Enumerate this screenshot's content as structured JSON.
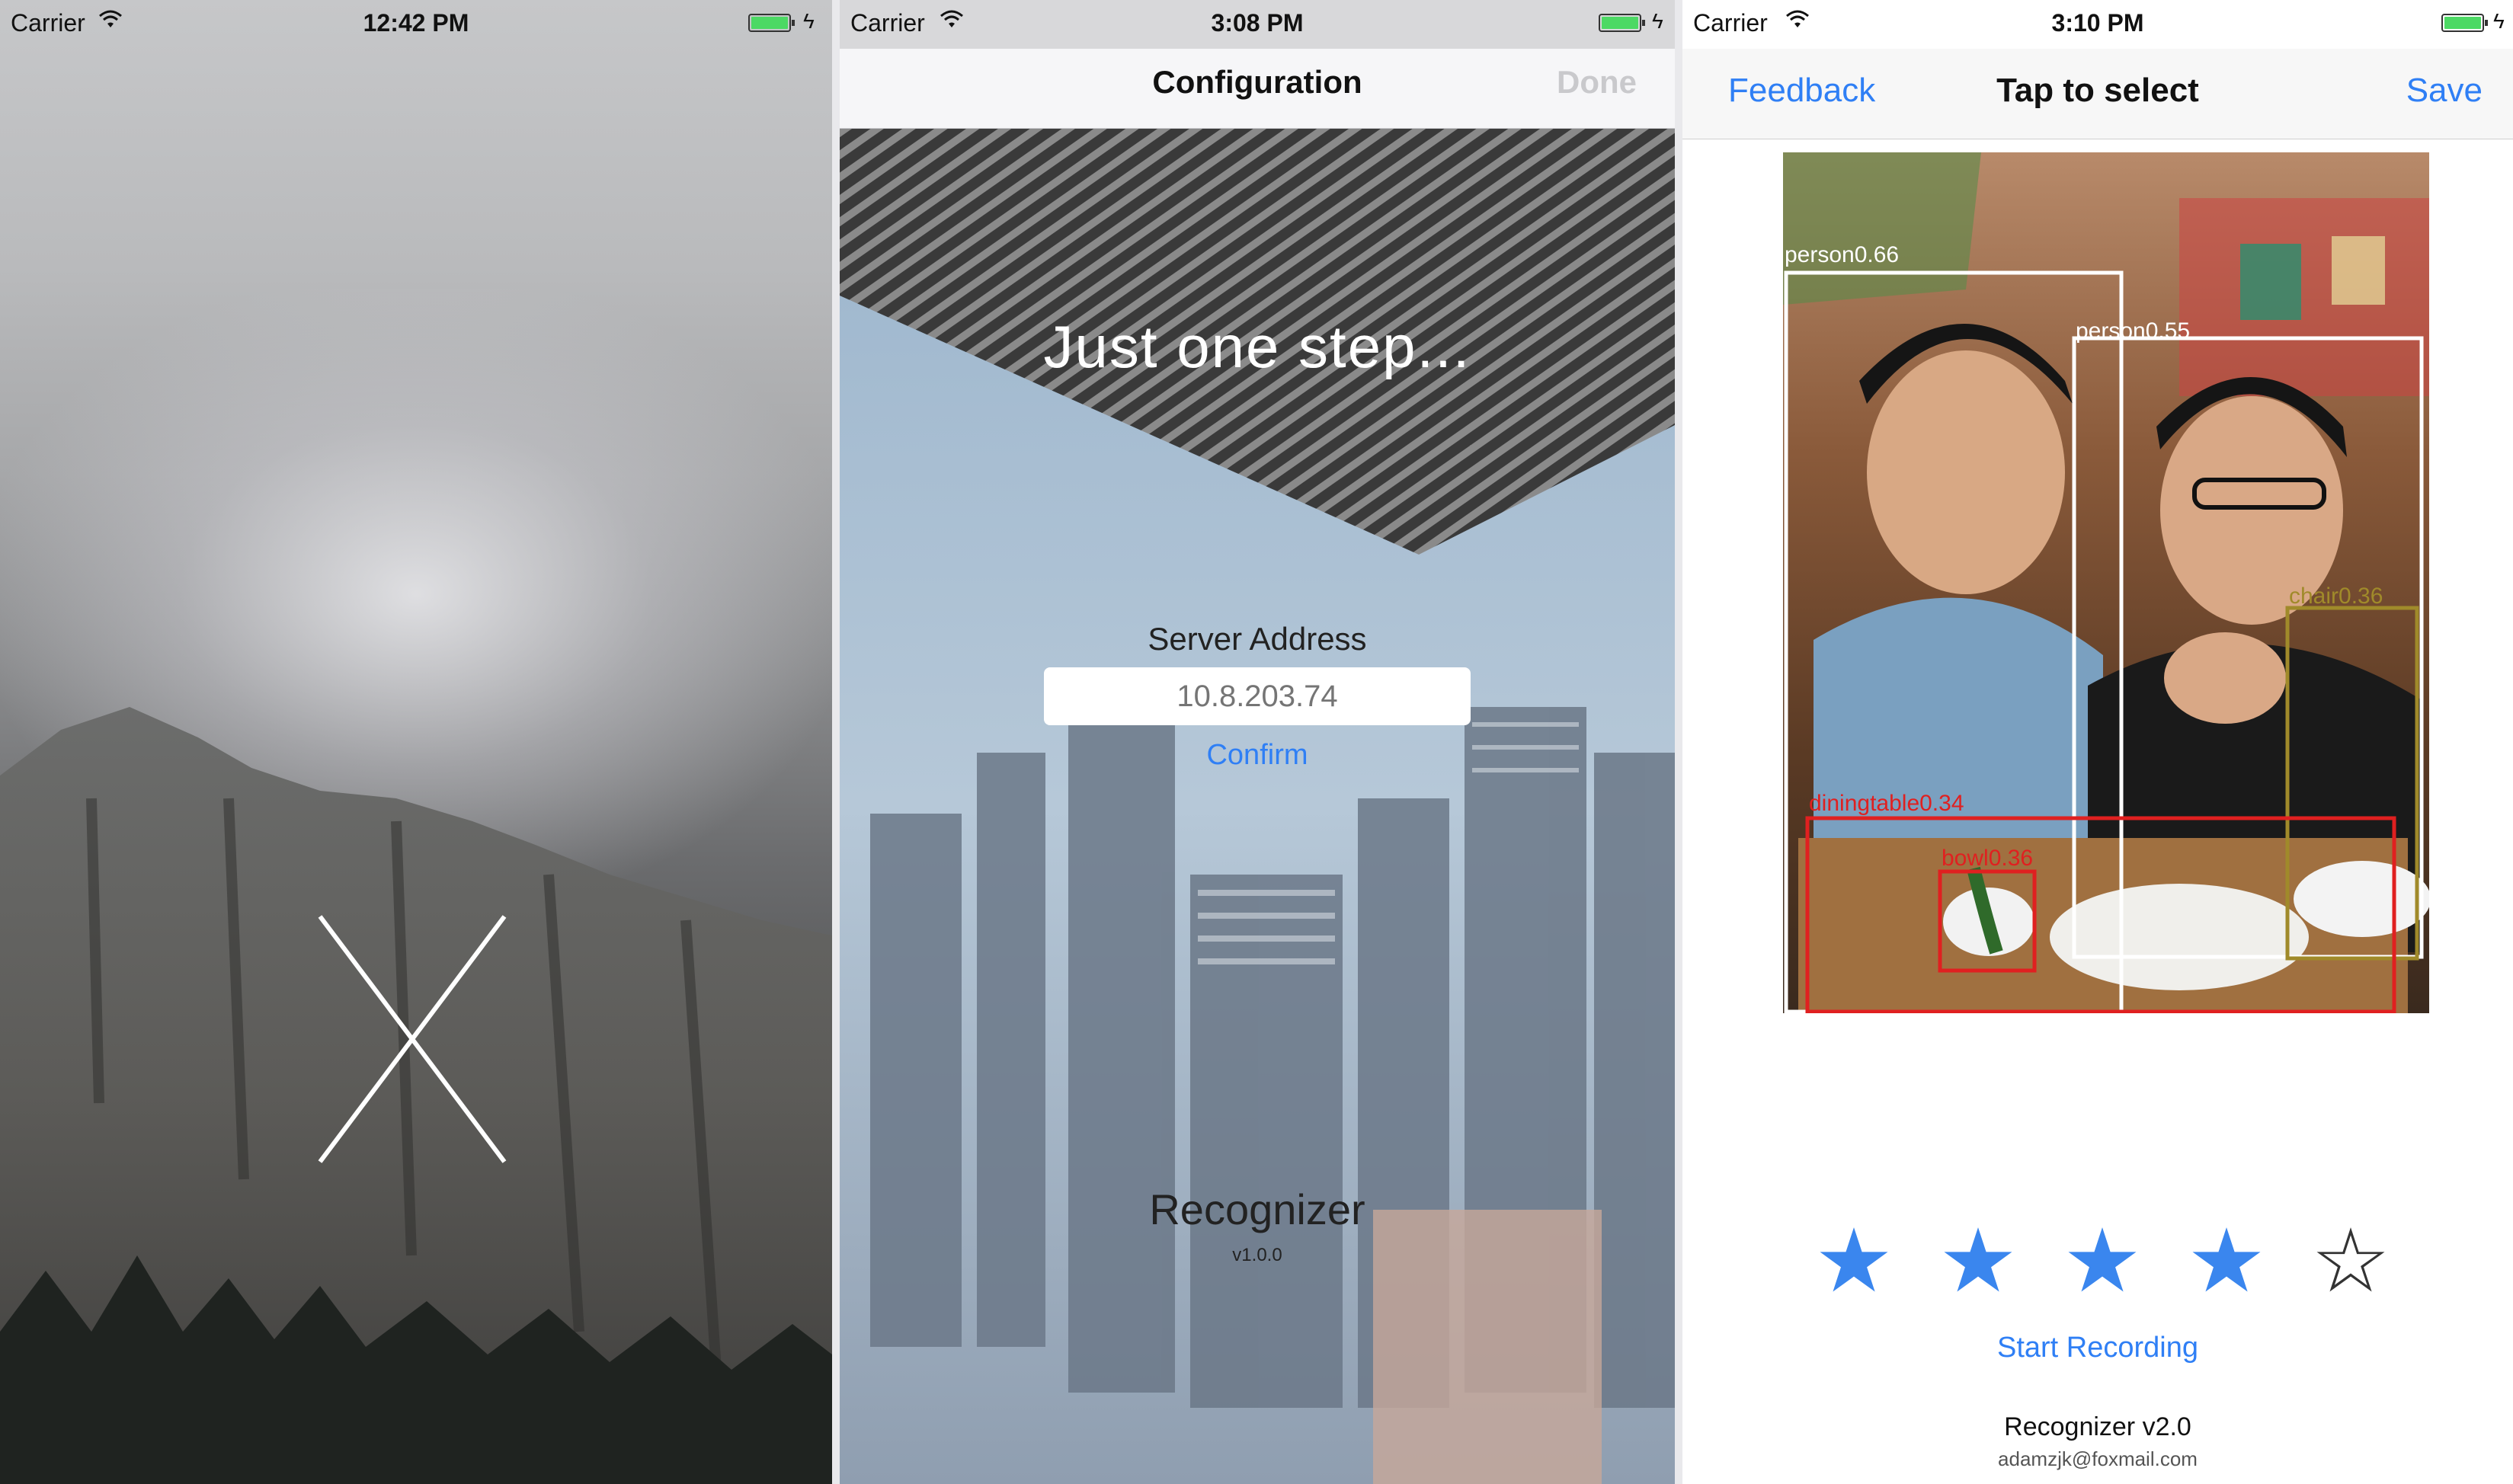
{
  "screen1": {
    "status": {
      "carrier": "Carrier",
      "time": "12:42 PM"
    }
  },
  "screen2": {
    "status": {
      "carrier": "Carrier",
      "time": "3:08 PM"
    },
    "nav": {
      "title": "Configuration",
      "done_label": "Done"
    },
    "headline": "Just one step...",
    "server_label": "Server Address",
    "server_placeholder": "10.8.203.74",
    "confirm_label": "Confirm",
    "app_name": "Recognizer",
    "app_version": "v1.0.0"
  },
  "screen3": {
    "status": {
      "carrier": "Carrier",
      "time": "3:10 PM"
    },
    "nav": {
      "left_label": "Feedback",
      "title": "Tap to select",
      "right_label": "Save"
    },
    "detections": [
      {
        "label": "person0.66",
        "color": "#ffffff"
      },
      {
        "label": "person0.55",
        "color": "#ffffff"
      },
      {
        "label": "chair0.36",
        "color": "#a08a2a"
      },
      {
        "label": "diningtable0.34",
        "color": "#e02020"
      },
      {
        "label": "bowl0.36",
        "color": "#e02020"
      }
    ],
    "rating": {
      "value": 4,
      "max": 5
    },
    "start_recording_label": "Start Recording",
    "footer_name": "Recognizer v2.0",
    "footer_email": "adamzjk@foxmail.com"
  },
  "colors": {
    "accent": "#2f7ff5",
    "star": "#3a86ee",
    "battery": "#4cd964"
  }
}
